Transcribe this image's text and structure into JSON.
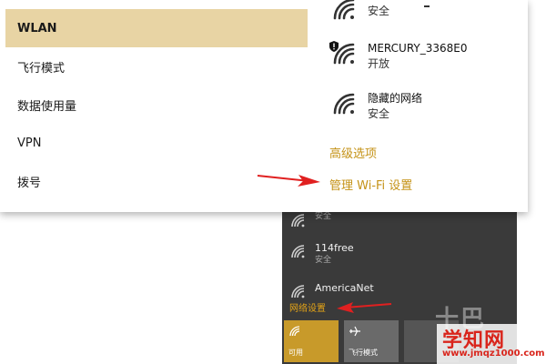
{
  "settings": {
    "nav_items": [
      {
        "label": "WLAN",
        "selected": true
      },
      {
        "label": "飞行模式"
      },
      {
        "label": "数据使用量"
      },
      {
        "label": "VPN"
      },
      {
        "label": "拨号"
      }
    ],
    "networks": [
      {
        "name": "",
        "status": "安全",
        "icon": "wifi-signal-icon"
      },
      {
        "name": "MERCURY_3368E0",
        "status": "开放",
        "icon": "wifi-warning-icon"
      },
      {
        "name": "隐藏的网络",
        "status": "安全",
        "icon": "wifi-signal-icon"
      }
    ],
    "advanced_link": "高级选项",
    "manage_wifi_link": "管理 Wi-Fi 设置"
  },
  "flyout": {
    "networks": [
      {
        "name": "",
        "status": "安全"
      },
      {
        "name": "114free",
        "status": "安全"
      },
      {
        "name": "AmericaNet",
        "status": ""
      }
    ],
    "settings_link": "网络设置",
    "tiles": [
      {
        "label": "可用",
        "state": "on"
      },
      {
        "label": "飞行模式",
        "state": "off"
      }
    ]
  },
  "watermark": {
    "faint": "十巴",
    "title": "学知网",
    "subtitle": "www.jmqz1000.com"
  },
  "colors": {
    "accent": "#c49216",
    "selected_bg": "#e8d4a4",
    "tile_on": "#c89a2a",
    "arrow": "#e02020",
    "watermark": "#d9251c"
  }
}
